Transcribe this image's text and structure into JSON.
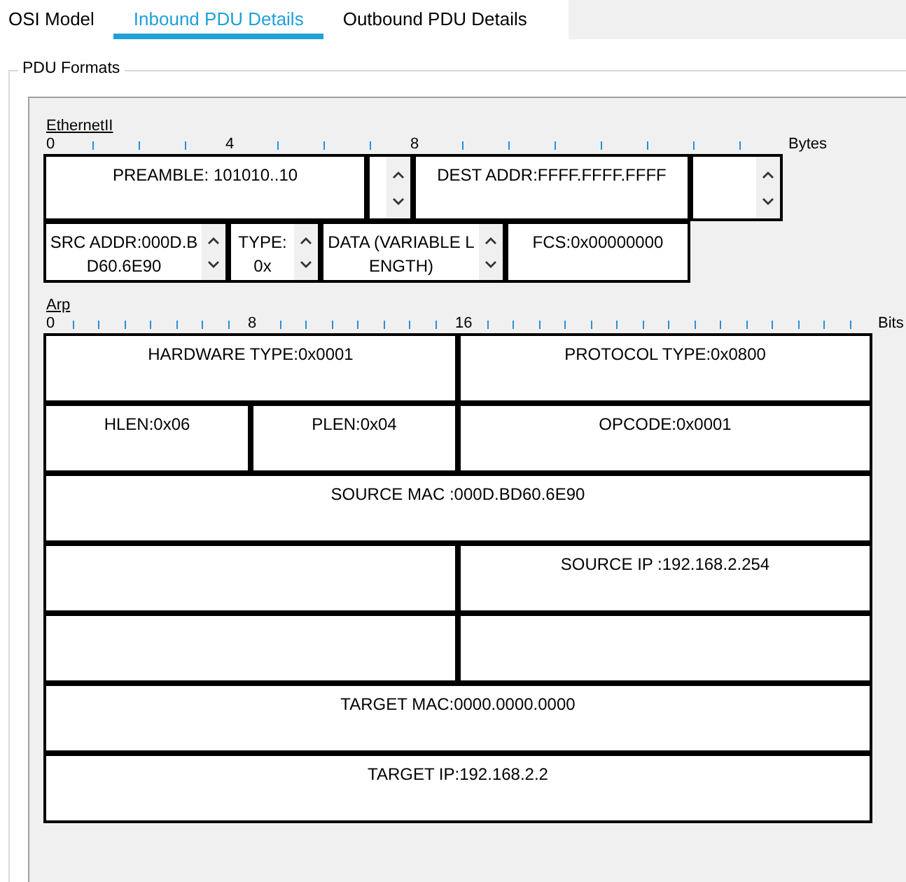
{
  "tabs": [
    {
      "label": "OSI Model",
      "selected": false
    },
    {
      "label": "Inbound PDU Details",
      "selected": true
    },
    {
      "label": "Outbound PDU Details",
      "selected": false
    }
  ],
  "group": {
    "title": "PDU Formats"
  },
  "sections": [
    {
      "title": "EthernetII",
      "ruler_labels": [
        "0",
        "4",
        "8"
      ],
      "unit": "Bytes",
      "rows": [
        [
          {
            "kind": "plain",
            "text": "PREAMBLE: 101010..10"
          },
          {
            "kind": "scrollable"
          },
          {
            "kind": "plain",
            "text": "DEST ADDR:FFFF.FFFF.FFFF"
          },
          {
            "kind": "scrollable"
          }
        ],
        [
          {
            "kind": "scrollable",
            "text": "SRC ADDR:000D.BD60.6E90"
          },
          {
            "kind": "scrollable",
            "text": "TYPE:0x"
          },
          {
            "kind": "scrollable",
            "text": "DATA (VARIABLE LENGTH)"
          },
          {
            "kind": "plain",
            "text": "FCS:0x00000000"
          }
        ]
      ]
    },
    {
      "title": "Arp",
      "ruler_labels": [
        "0",
        "8",
        "16"
      ],
      "unit": "Bits",
      "rows": [
        [
          {
            "kind": "plain",
            "text": "HARDWARE TYPE:0x0001"
          },
          {
            "kind": "plain",
            "text": "PROTOCOL TYPE:0x0800"
          }
        ],
        [
          {
            "kind": "plain",
            "text": "HLEN:0x06"
          },
          {
            "kind": "plain",
            "text": "PLEN:0x04"
          },
          {
            "kind": "plain",
            "text": "OPCODE:0x0001"
          }
        ],
        [
          {
            "kind": "plain",
            "text": "SOURCE MAC :000D.BD60.6E90"
          }
        ],
        [
          {
            "kind": "empty"
          },
          {
            "kind": "plain",
            "text": "SOURCE IP :192.168.2.254"
          }
        ],
        [
          {
            "kind": "empty"
          },
          {
            "kind": "empty"
          }
        ],
        [
          {
            "kind": "plain",
            "text": "TARGET MAC:0000.0000.0000"
          }
        ],
        [
          {
            "kind": "plain",
            "text": "TARGET IP:192.168.2.2"
          }
        ]
      ]
    }
  ]
}
